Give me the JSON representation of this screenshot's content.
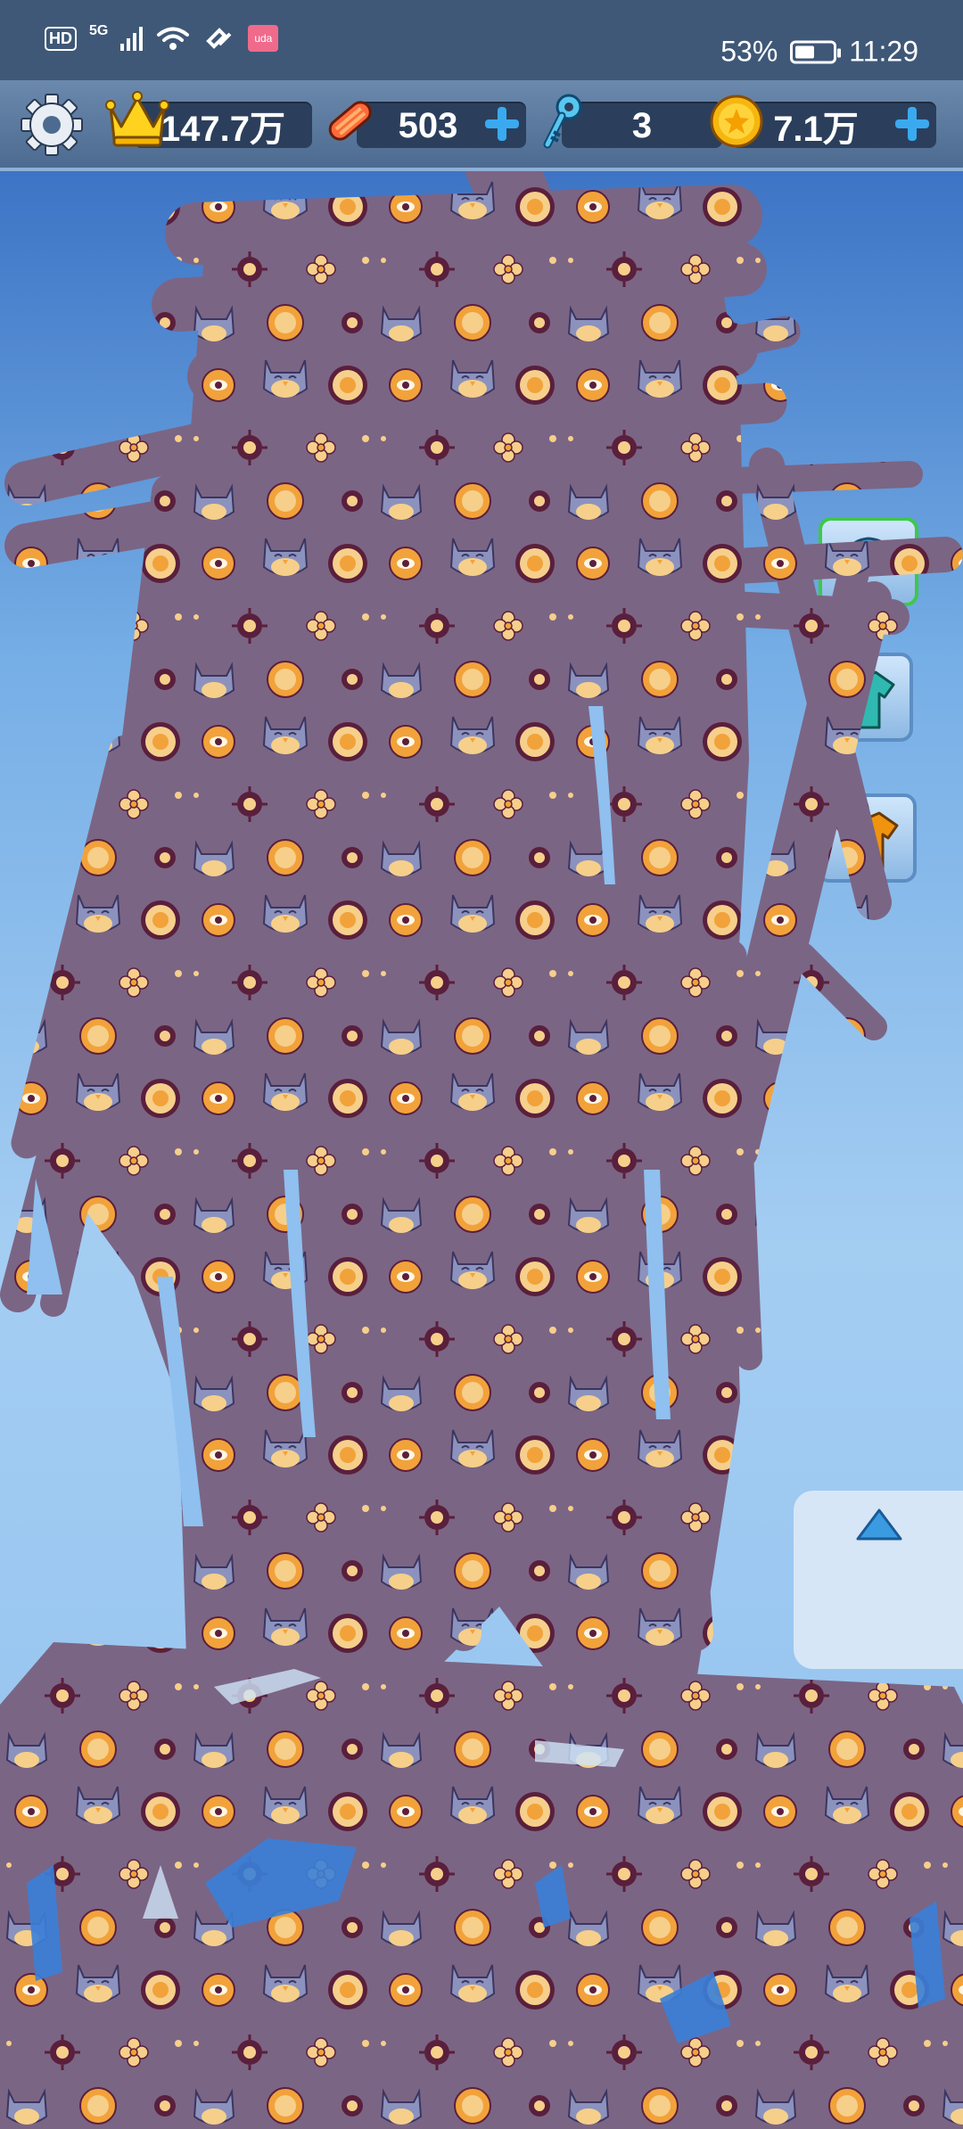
{
  "status_bar": {
    "hd": "HD",
    "network": "5G",
    "app_badge": "uda",
    "battery_text": "53%",
    "battery_level": 0.53,
    "time": "11:29"
  },
  "resources": {
    "crown_value": "147.7万",
    "board_value": "503",
    "key_value": "3",
    "coin_value": "7.1万"
  },
  "icons": {
    "settings": "gear-icon",
    "crown": "crown-icon",
    "board": "skateboard-icon",
    "key": "key-icon",
    "coin": "coin-icon",
    "add": "plus-icon",
    "outfit_hat": "hat-icon",
    "outfit_shirt_teal": "teal-shirt-icon",
    "outfit_shirt_orange": "orange-shirt-icon",
    "up": "up-arrow-icon"
  },
  "colors": {
    "statusbar": "#3f5877",
    "resource_bar": "#4d6b90",
    "pattern_bg": "#7b6584",
    "pattern_orange": "#f2a23a",
    "pattern_cream": "#f6cf8b",
    "pattern_dark": "#5a1f3c",
    "owl": "#8b92bd"
  }
}
